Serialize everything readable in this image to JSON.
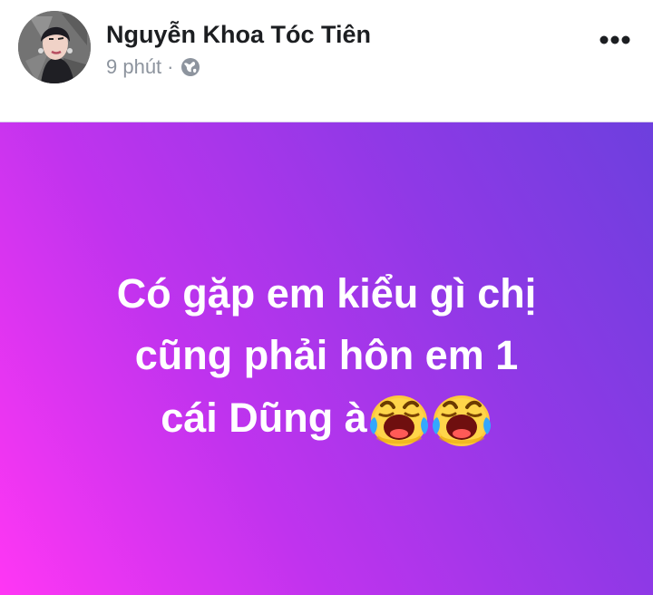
{
  "post": {
    "author": "Nguyễn Khoa Tóc Tiên",
    "timestamp": "9 phút",
    "separator": "·",
    "privacy_icon": "globe-icon",
    "more_icon": "more-options-icon",
    "background_colors": [
      "#ff36f4",
      "#c033ee",
      "#8f39e6",
      "#6d3fde"
    ],
    "status_lines": [
      "Có gặp em kiểu gì chị",
      "cũng phải hôn em 1",
      "cái Dũng à"
    ],
    "emoji": [
      "loudly-crying-face-icon",
      "loudly-crying-face-icon"
    ]
  }
}
